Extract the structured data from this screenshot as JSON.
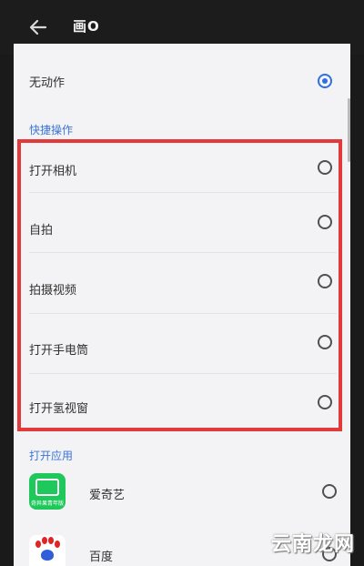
{
  "header": {
    "title": "画O"
  },
  "options": {
    "no_action": {
      "label": "无动作",
      "selected": true
    },
    "quick_section": "快捷操作",
    "quick_items": [
      {
        "label": "打开相机",
        "selected": false
      },
      {
        "label": "自拍",
        "selected": false
      },
      {
        "label": "拍摄视频",
        "selected": false
      },
      {
        "label": "打开手电筒",
        "selected": false
      },
      {
        "label": "打开氢视窗",
        "selected": false
      }
    ],
    "apps_section": "打开应用",
    "apps": [
      {
        "label": "爱奇艺",
        "icon": "iqiyi-icon",
        "icon_text": "奇异果青年版",
        "selected": false
      },
      {
        "label": "百度",
        "icon": "baidu-icon",
        "selected": false
      }
    ]
  },
  "watermark": "云南龙网",
  "colors": {
    "accent": "#2f6fe0",
    "section": "#3c74d8",
    "highlight": "#e23a3a",
    "iqiyi": "#1fc85a"
  }
}
